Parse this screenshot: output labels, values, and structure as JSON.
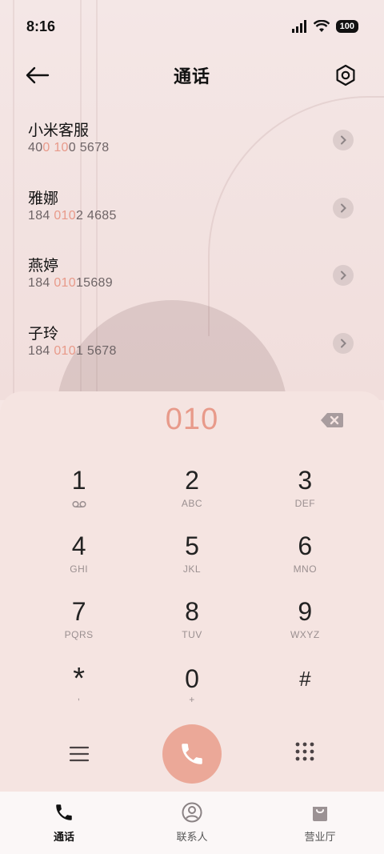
{
  "status_bar": {
    "time": "8:16",
    "battery": "100"
  },
  "header": {
    "title": "通话",
    "back_icon": "arrow-left-icon",
    "settings_icon": "hexagon-gear-icon"
  },
  "contacts": [
    {
      "name": "小米客服",
      "number_parts": [
        "40",
        "0 10",
        "0 5678"
      ]
    },
    {
      "name": "雅娜",
      "number_parts": [
        "184 ",
        "010",
        "2 4685"
      ]
    },
    {
      "name": "燕婷",
      "number_parts": [
        "184 ",
        "010",
        "15689"
      ]
    },
    {
      "name": "子玲",
      "number_parts": [
        "184 ",
        "010",
        "1 5678"
      ]
    }
  ],
  "dialpad": {
    "input": "010",
    "keys": [
      [
        {
          "digit": "1",
          "letters": "voicemail"
        },
        {
          "digit": "2",
          "letters": "ABC"
        },
        {
          "digit": "3",
          "letters": "DEF"
        }
      ],
      [
        {
          "digit": "4",
          "letters": "GHI"
        },
        {
          "digit": "5",
          "letters": "JKL"
        },
        {
          "digit": "6",
          "letters": "MNO"
        }
      ],
      [
        {
          "digit": "7",
          "letters": "PQRS"
        },
        {
          "digit": "8",
          "letters": "TUV"
        },
        {
          "digit": "9",
          "letters": "WXYZ"
        }
      ],
      [
        {
          "digit": "*",
          "letters": ","
        },
        {
          "digit": "0",
          "letters": "+"
        },
        {
          "digit": "#",
          "letters": ""
        }
      ]
    ],
    "call_color": "#eba898"
  },
  "bottom_nav": {
    "tabs": [
      {
        "label": "通话",
        "icon": "phone-icon",
        "active": true
      },
      {
        "label": "联系人",
        "icon": "contact-icon",
        "active": false
      },
      {
        "label": "营业厅",
        "icon": "shopping-bag-icon",
        "active": false
      }
    ]
  },
  "colors": {
    "accent": "#e89a8a",
    "panel": "#f5e4e1"
  }
}
